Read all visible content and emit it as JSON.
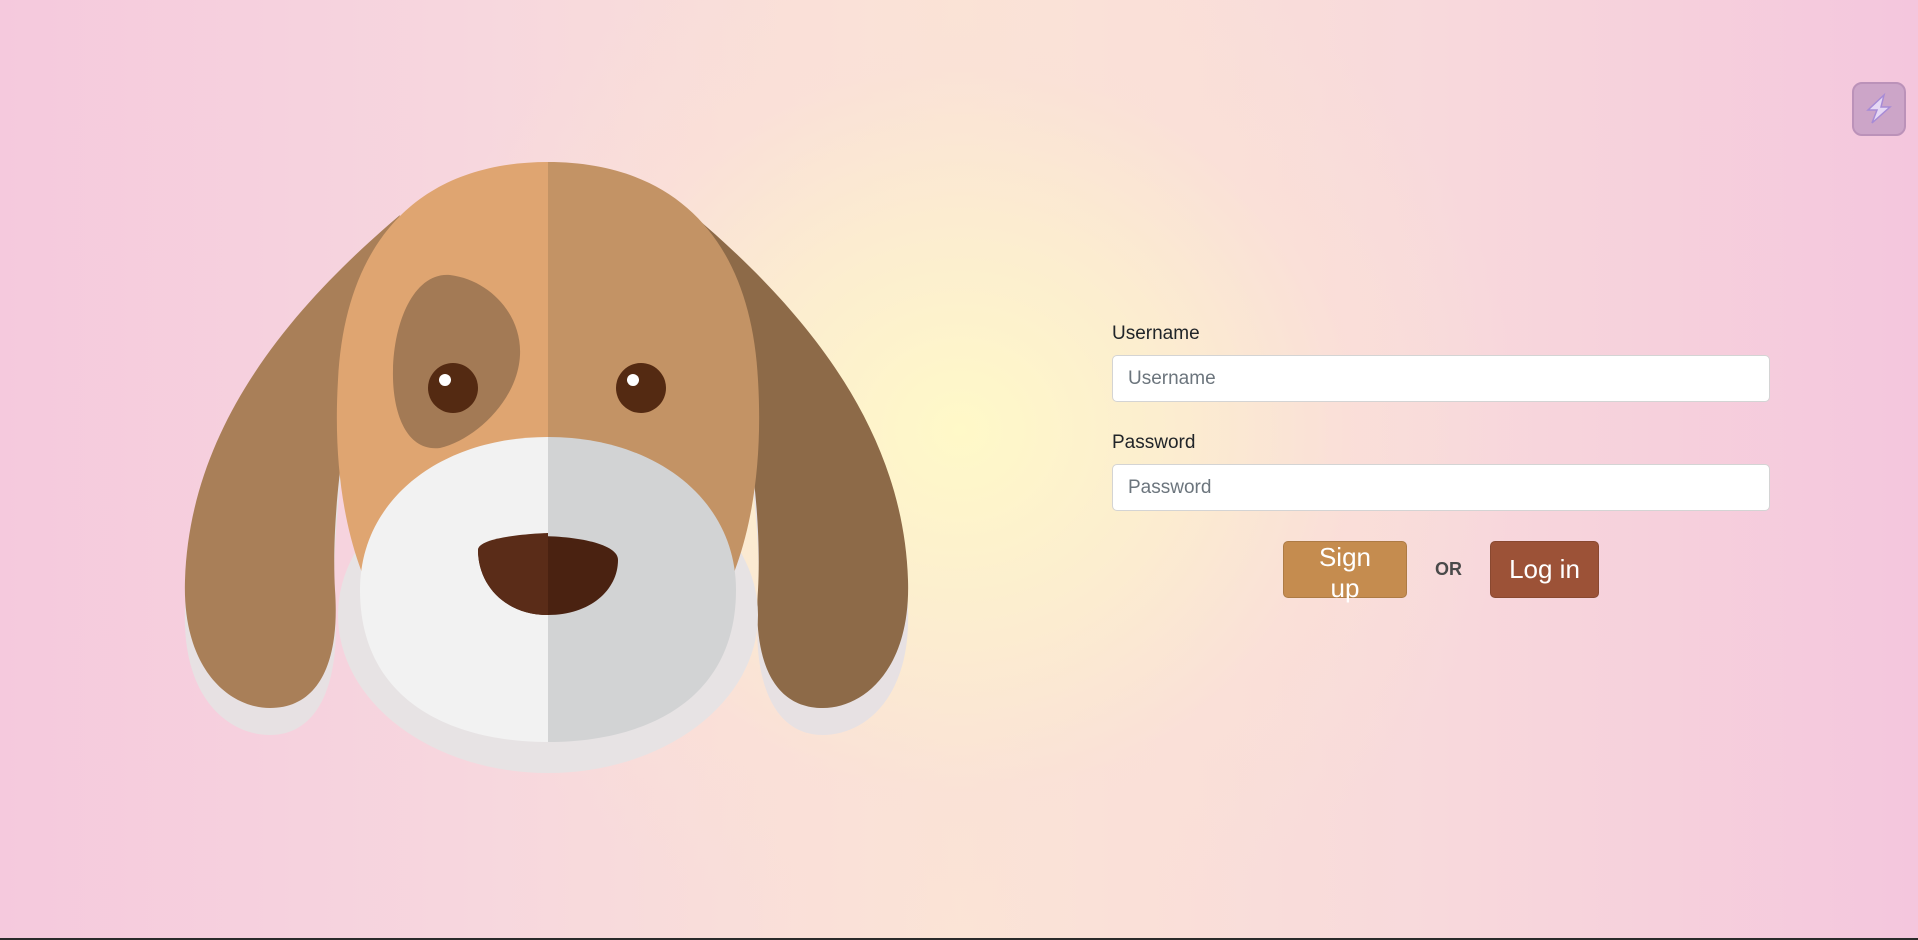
{
  "form": {
    "username_label": "Username",
    "username_placeholder": "Username",
    "password_label": "Password",
    "password_placeholder": "Password",
    "signup_label": "Sign up",
    "or_text": "OR",
    "login_label": "Log in"
  },
  "colors": {
    "signup_button": "#c58c4f",
    "login_button": "#9c5237",
    "background_pink": "#f5c9dd",
    "background_yellow": "#fff9c8"
  },
  "icons": {
    "illustration": "dog-face-illustration",
    "corner_widget": "lightning-icon"
  }
}
